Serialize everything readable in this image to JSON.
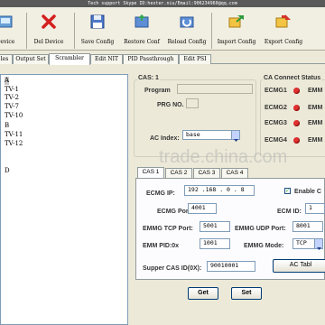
{
  "header": {
    "support_text": "Tech support Skype ID:hexter.niu/Email:906234960@qq.com"
  },
  "toolbar": {
    "items": [
      {
        "label": "Device",
        "icon": "add-device-icon"
      },
      {
        "label": "Del Device",
        "icon": "delete-icon"
      },
      {
        "label": "Save Config",
        "icon": "save-icon"
      },
      {
        "label": "Restore Conf",
        "icon": "restore-icon"
      },
      {
        "label": "Reload Config",
        "icon": "reload-icon"
      },
      {
        "label": "Import Config",
        "icon": "import-icon"
      },
      {
        "label": "Export Config",
        "icon": "export-icon"
      }
    ]
  },
  "tabs": [
    "les",
    "Output Set",
    "Scrambler",
    "Edit NIT",
    "PID Passthrough",
    "Edit PSI"
  ],
  "active_tab": "Scrambler",
  "tree": {
    "items": [
      "A",
      "TV-1",
      "TV-2",
      "TV-7",
      "TV-10",
      "B",
      "TV-11",
      "TV-12",
      "D"
    ]
  },
  "cas": {
    "title": "CAS: 1",
    "program_label": "Program",
    "program_value": "",
    "prg_no_label": "PRG NO.",
    "prg_no_value": "",
    "ac_index_label": "AC Index:",
    "ac_index_value": "base"
  },
  "ca_status": {
    "title": "CA Connect Status",
    "ecmg": [
      "ECMG1",
      "ECMG2",
      "ECMG3",
      "ECMG4"
    ],
    "emmg": [
      "EMM",
      "EMM",
      "EMM",
      "EMM"
    ],
    "led_color": "#e03030"
  },
  "watermark": "trade.china.com",
  "cas_tabs": [
    "CAS 1",
    "CAS 2",
    "CAS 3",
    "CAS 4"
  ],
  "cas_form": {
    "ecmg_ip_label": "ECMG IP:",
    "ecmg_ip_value": "192 .168 . 0  . 8",
    "enable_label": "Enable C",
    "enable_checked": true,
    "ecmg_port_label": "ECMG Port:",
    "ecmg_port_value": "4001",
    "ecm_id_label": "ECM ID:",
    "ecm_id_value": "1",
    "emmg_tcp_label": "EMMG TCP Port:",
    "emmg_tcp_value": "5001",
    "emmg_udp_label": "EMMG UDP Port:",
    "emmg_udp_value": "8001",
    "emm_pid_label": "EMM PID:0x",
    "emm_pid_value": "1001",
    "emmg_mode_label": "EMMG Mode:",
    "emmg_mode_value": "TCP",
    "super_cas_label": "Supper CAS ID(0X):",
    "super_cas_value": "90010001",
    "ac_table_label": "AC Tabl"
  },
  "buttons": {
    "get": "Get",
    "set": "Set"
  }
}
